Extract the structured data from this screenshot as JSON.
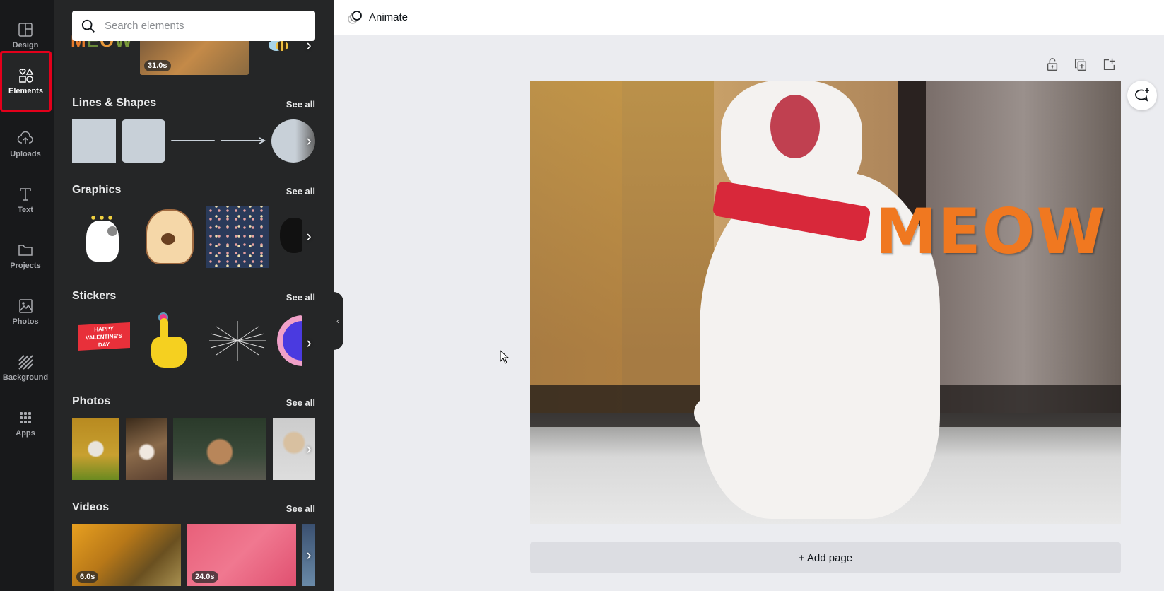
{
  "rail": {
    "items": [
      {
        "label": "Design",
        "icon": "layout-icon"
      },
      {
        "label": "Elements",
        "icon": "shapes-icon",
        "active": true
      },
      {
        "label": "Uploads",
        "icon": "cloud-upload-icon"
      },
      {
        "label": "Text",
        "icon": "text-icon"
      },
      {
        "label": "Projects",
        "icon": "folder-icon"
      },
      {
        "label": "Photos",
        "icon": "image-icon"
      },
      {
        "label": "Background",
        "icon": "stripes-icon"
      },
      {
        "label": "Apps",
        "icon": "grid-icon"
      }
    ],
    "active_border_color": "#e3001b"
  },
  "panel": {
    "search": {
      "placeholder": "Search elements"
    },
    "top_row": {
      "video_duration": "31.0s"
    },
    "sections": [
      {
        "title": "Lines & Shapes",
        "see_all": "See all"
      },
      {
        "title": "Graphics",
        "see_all": "See all"
      },
      {
        "title": "Stickers",
        "see_all": "See all",
        "sticker_text": "HAPPY VALENTINE'S DAY"
      },
      {
        "title": "Photos",
        "see_all": "See all"
      },
      {
        "title": "Videos",
        "see_all": "See all",
        "durations": [
          "6.0s",
          "24.0s"
        ]
      }
    ]
  },
  "topbar": {
    "animate_label": "Animate"
  },
  "canvas": {
    "overlay_text": "MEOW"
  },
  "footer": {
    "add_page_label": "+ Add page"
  }
}
